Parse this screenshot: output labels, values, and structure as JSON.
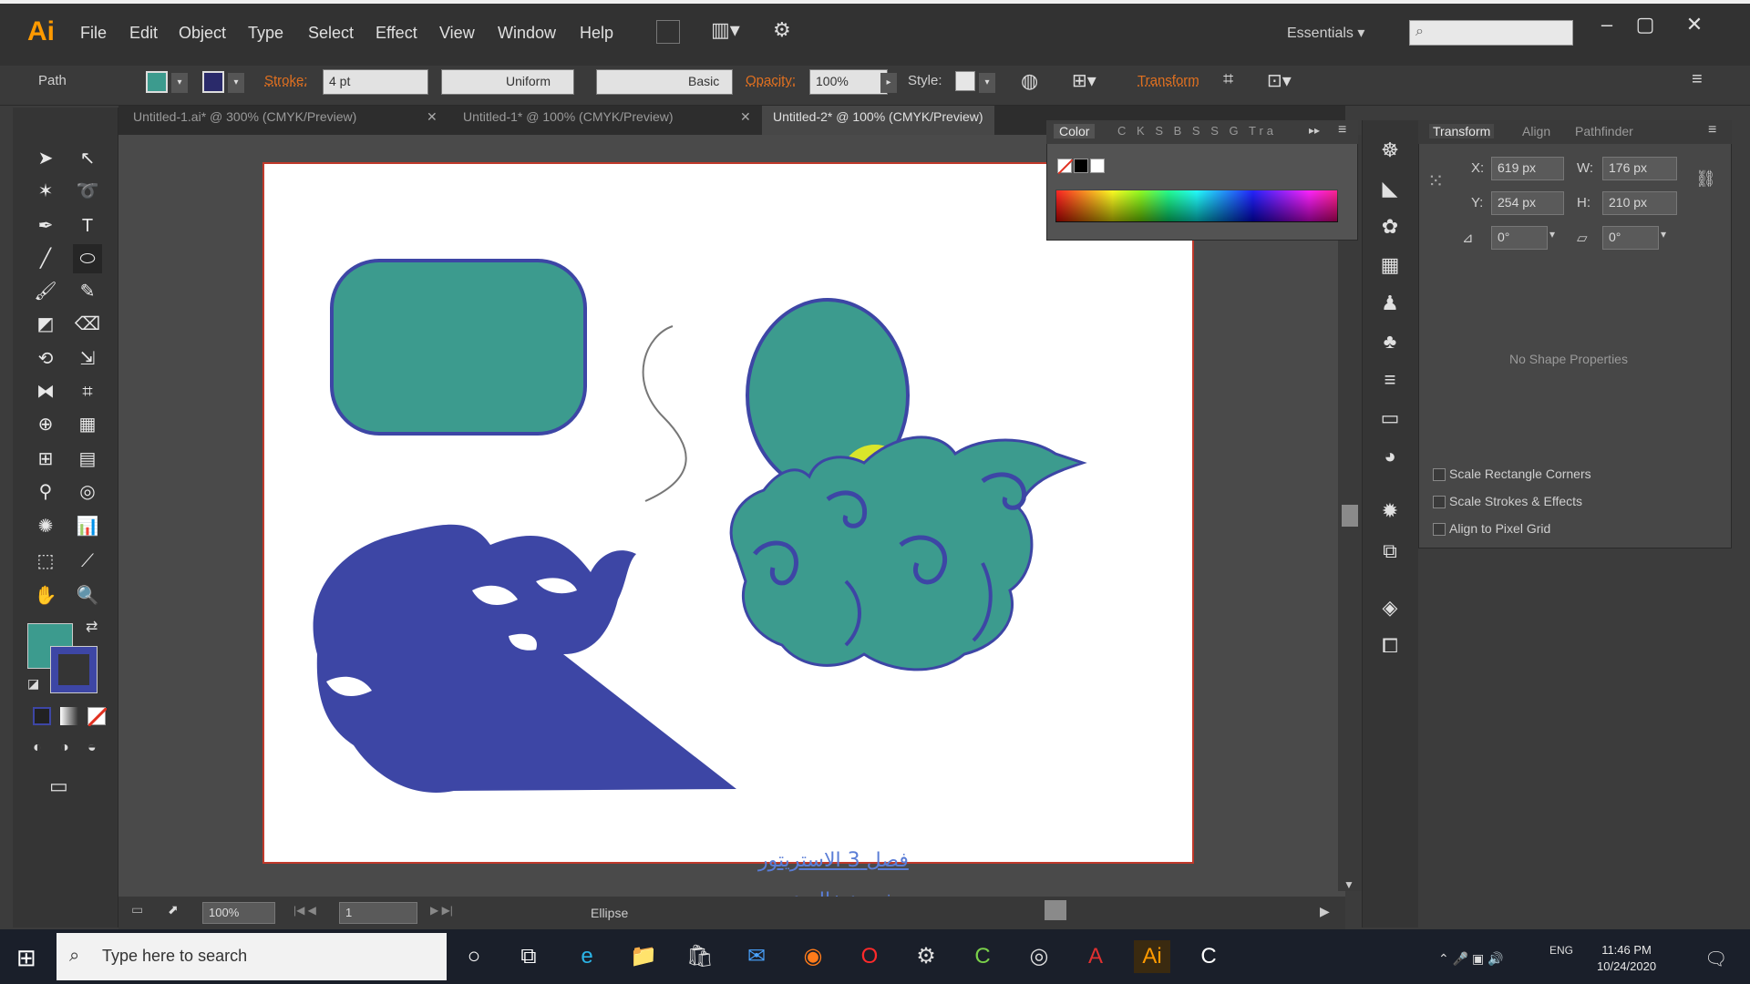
{
  "app": {
    "logo": "Ai"
  },
  "menu": [
    "File",
    "Edit",
    "Object",
    "Type",
    "Select",
    "Effect",
    "View",
    "Window",
    "Help"
  ],
  "workspace_label": "Essentials",
  "control_bar": {
    "path_label": "Path",
    "stroke_label": "Stroke:",
    "stroke_weight": "4 pt",
    "profile": "Uniform",
    "brush": "Basic",
    "opacity_label": "Opacity:",
    "opacity_value": "100%",
    "style_label": "Style:",
    "transform_label": "Transform",
    "fill_color": "#3c9b8e",
    "stroke_color": "#3d46a5"
  },
  "tabs": [
    {
      "label": "Untitled-1.ai* @ 300% (CMYK/Preview)"
    },
    {
      "label": "Untitled-1* @ 100% (CMYK/Preview)"
    },
    {
      "label": "Untitled-2* @ 100% (CMYK/Preview)"
    }
  ],
  "color_panel": {
    "title": "Color",
    "other_tabs": [
      "C",
      "K",
      "S",
      "B",
      "S",
      "S",
      "G",
      "Tra"
    ]
  },
  "transform_panel": {
    "tabs": [
      "Transform",
      "Align",
      "Pathfinder"
    ],
    "x_label": "X:",
    "x": "619 px",
    "y_label": "Y:",
    "y": "254 px",
    "w_label": "W:",
    "w": "176 px",
    "h_label": "H:",
    "h": "210 px",
    "rotate": "0°",
    "shear": "0°",
    "no_shape": "No Shape Properties",
    "checks": [
      "Scale Rectangle Corners",
      "Scale Strokes & Effects",
      "Align to Pixel Grid"
    ]
  },
  "status": {
    "zoom": "100%",
    "page": "1",
    "tool": "Ellipse"
  },
  "caption": {
    "line1": "فصل 3 الاستريتور",
    "line2": "شرح: خالد عيسى"
  },
  "taskbar": {
    "search_placeholder": "Type here to search",
    "time": "11:46 PM",
    "date": "10/24/2020",
    "lang": "ENG"
  },
  "colors": {
    "teal": "#3c9b8e",
    "indigo": "#3d46a5",
    "artboard_border": "#c0392b",
    "highlight": "#f5f21a"
  }
}
